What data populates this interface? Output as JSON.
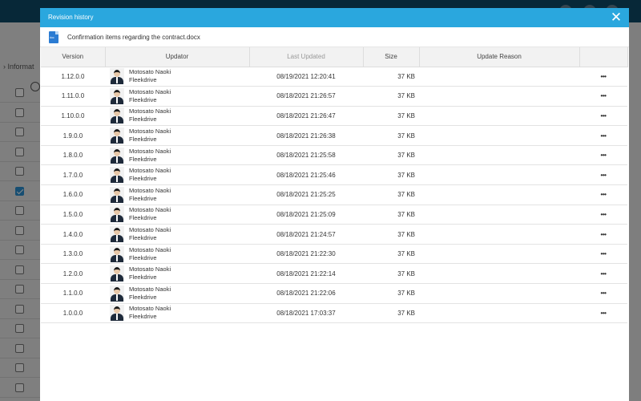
{
  "background": {
    "breadcrumb": "› Informat",
    "checked_row_index": 5
  },
  "modal": {
    "title": "Revision history",
    "file_name": "Confirmation items regarding the contract.docx",
    "file_icon_label": "doc"
  },
  "columns": {
    "version": "Version",
    "updator": "Updator",
    "last_updated": "Last Updated",
    "size": "Size",
    "update_reason": "Update Reason"
  },
  "rows": [
    {
      "version": "1.12.0.0",
      "name": "Motosato Naoki",
      "org": "Fleekdrive",
      "date": "08/19/2021 12:20:41",
      "size": "37 KB",
      "reason": "",
      "menu": "•••"
    },
    {
      "version": "1.11.0.0",
      "name": "Motosato Naoki",
      "org": "Fleekdrive",
      "date": "08/18/2021 21:26:57",
      "size": "37 KB",
      "reason": "",
      "menu": "•••"
    },
    {
      "version": "1.10.0.0",
      "name": "Motosato Naoki",
      "org": "Fleekdrive",
      "date": "08/18/2021 21:26:47",
      "size": "37 KB",
      "reason": "",
      "menu": "•••"
    },
    {
      "version": "1.9.0.0",
      "name": "Motosato Naoki",
      "org": "Fleekdrive",
      "date": "08/18/2021 21:26:38",
      "size": "37 KB",
      "reason": "",
      "menu": "•••"
    },
    {
      "version": "1.8.0.0",
      "name": "Motosato Naoki",
      "org": "Fleekdrive",
      "date": "08/18/2021 21:25:58",
      "size": "37 KB",
      "reason": "",
      "menu": "•••"
    },
    {
      "version": "1.7.0.0",
      "name": "Motosato Naoki",
      "org": "Fleekdrive",
      "date": "08/18/2021 21:25:46",
      "size": "37 KB",
      "reason": "",
      "menu": "•••"
    },
    {
      "version": "1.6.0.0",
      "name": "Motosato Naoki",
      "org": "Fleekdrive",
      "date": "08/18/2021 21:25:25",
      "size": "37 KB",
      "reason": "",
      "menu": "•••"
    },
    {
      "version": "1.5.0.0",
      "name": "Motosato Naoki",
      "org": "Fleekdrive",
      "date": "08/18/2021 21:25:09",
      "size": "37 KB",
      "reason": "",
      "menu": "•••"
    },
    {
      "version": "1.4.0.0",
      "name": "Motosato Naoki",
      "org": "Fleekdrive",
      "date": "08/18/2021 21:24:57",
      "size": "37 KB",
      "reason": "",
      "menu": "•••"
    },
    {
      "version": "1.3.0.0",
      "name": "Motosato Naoki",
      "org": "Fleekdrive",
      "date": "08/18/2021 21:22:30",
      "size": "37 KB",
      "reason": "",
      "menu": "•••"
    },
    {
      "version": "1.2.0.0",
      "name": "Motosato Naoki",
      "org": "Fleekdrive",
      "date": "08/18/2021 21:22:14",
      "size": "37 KB",
      "reason": "",
      "menu": "•••"
    },
    {
      "version": "1.1.0.0",
      "name": "Motosato Naoki",
      "org": "Fleekdrive",
      "date": "08/18/2021 21:22:06",
      "size": "37 KB",
      "reason": "",
      "menu": "•••"
    },
    {
      "version": "1.0.0.0",
      "name": "Motosato Naoki",
      "org": "Fleekdrive",
      "date": "08/18/2021 17:03:37",
      "size": "37 KB",
      "reason": "",
      "menu": "•••"
    }
  ],
  "colors": {
    "header_blue": "#2aa7de",
    "topbar": "#0e4a66",
    "checkbox_checked": "#2a8fd0"
  },
  "icons": {
    "close": "close-icon",
    "file": "docx-file-icon",
    "row_menu": "more-options-icon",
    "avatar": "user-avatar"
  }
}
